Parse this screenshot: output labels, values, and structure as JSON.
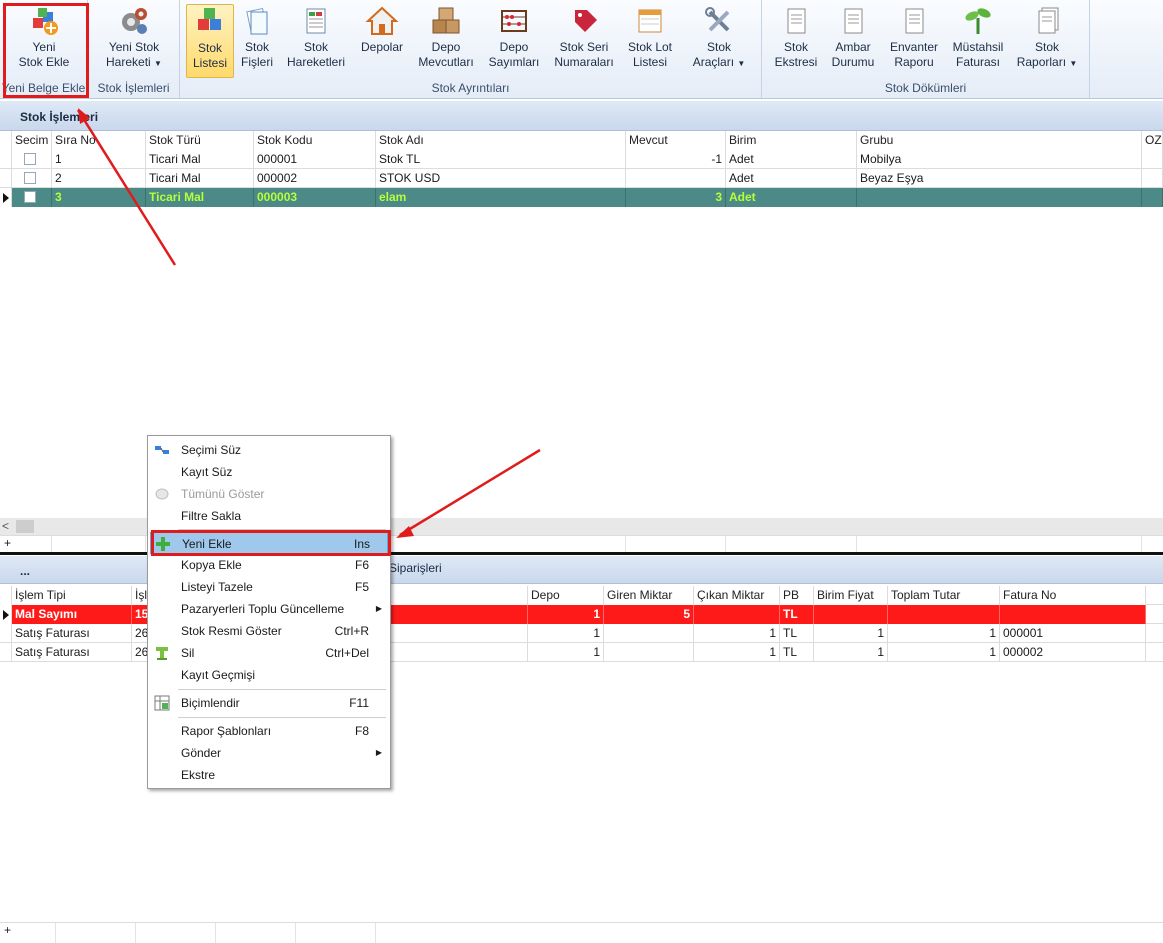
{
  "ribbon": {
    "groups": {
      "yeni_belge": {
        "label": "Yeni Belge Ekle"
      },
      "stok_islemleri": {
        "label": "Stok İşlemleri"
      },
      "stok_ayrintilari": {
        "label": "Stok Ayrıntıları"
      },
      "stok_dokumleri": {
        "label": "Stok Dökümleri"
      }
    },
    "buttons": {
      "yeni_stok_ekle": {
        "line1": "Yeni",
        "line2": "Stok Ekle"
      },
      "yeni_stok_hareketi": {
        "line1": "Yeni Stok",
        "line2": "Hareketi"
      },
      "stok_listesi": {
        "line1": "Stok",
        "line2": "Listesi"
      },
      "stok_fisleri": {
        "line1": "Stok",
        "line2": "Fişleri"
      },
      "stok_hareketleri": {
        "line1": "Stok",
        "line2": "Hareketleri"
      },
      "depolar": {
        "line1": "Depolar",
        "line2": ""
      },
      "depo_mevcutlari": {
        "line1": "Depo",
        "line2": "Mevcutları"
      },
      "depo_sayimlari": {
        "line1": "Depo",
        "line2": "Sayımları"
      },
      "stok_seri": {
        "line1": "Stok Seri",
        "line2": "Numaraları"
      },
      "stok_lot": {
        "line1": "Stok Lot",
        "line2": "Listesi"
      },
      "stok_araclari": {
        "line1": "Stok",
        "line2": "Araçları"
      },
      "stok_ekstresi": {
        "line1": "Stok",
        "line2": "Ekstresi"
      },
      "ambar_durumu": {
        "line1": "Ambar",
        "line2": "Durumu"
      },
      "envanter_raporu": {
        "line1": "Envanter",
        "line2": "Raporu"
      },
      "mustahsil": {
        "line1": "Müstahsil",
        "line2": "Faturası"
      },
      "stok_raporlari": {
        "line1": "Stok",
        "line2": "Raporları"
      }
    }
  },
  "top_panel": {
    "title": "Stok İşlemleri",
    "columns": [
      "Secim",
      "Sıra No",
      "Stok Türü",
      "Stok Kodu",
      "Stok Adı",
      "Mevcut",
      "Birim",
      "Grubu",
      "OZ"
    ],
    "rows": [
      {
        "sira": "1",
        "tur": "Ticari Mal",
        "kod": "000001",
        "ad": "Stok TL",
        "mevcut": "-1",
        "birim": "Adet",
        "grup": "Mobilya"
      },
      {
        "sira": "2",
        "tur": "Ticari Mal",
        "kod": "000002",
        "ad": "STOK USD",
        "mevcut": "",
        "birim": "Adet",
        "grup": "Beyaz Eşya"
      },
      {
        "sira": "3",
        "tur": "Ticari Mal",
        "kod": "000003",
        "ad": "elam",
        "mevcut": "3",
        "birim": "Adet",
        "grup": ""
      }
    ]
  },
  "bottom_panel": {
    "title": "...",
    "title_right": "Siparişleri",
    "columns": [
      "İşlem Tipi",
      "İşl",
      "Depo",
      "Giren Miktar",
      "Çıkan Miktar",
      "PB",
      "Birim Fiyat",
      "Toplam Tutar",
      "Fatura No"
    ],
    "rows": [
      {
        "tip": "Mal Sayımı",
        "isl": "15",
        "depo": "1",
        "giren": "5",
        "cikan": "",
        "pb": "TL",
        "fiyat": "",
        "toplam": "",
        "fatura": ""
      },
      {
        "tip": "Satış Faturası",
        "isl": "26",
        "depo": "1",
        "giren": "",
        "cikan": "1",
        "pb": "TL",
        "fiyat": "1",
        "toplam": "1",
        "fatura": "000001"
      },
      {
        "tip": "Satış Faturası",
        "isl": "26",
        "depo": "1",
        "giren": "",
        "cikan": "1",
        "pb": "TL",
        "fiyat": "1",
        "toplam": "1",
        "fatura": "000002"
      }
    ]
  },
  "footer": {
    "plus": "+"
  },
  "context_menu": {
    "items": [
      {
        "label": "Seçimi Süz",
        "key": ""
      },
      {
        "label": "Kayıt Süz",
        "key": ""
      },
      {
        "label": "Tümünü Göster",
        "key": ""
      },
      {
        "label": "Filtre Sakla",
        "key": ""
      },
      {
        "label": "Yeni Ekle",
        "key": "Ins"
      },
      {
        "label": "Kopya Ekle",
        "key": "F6"
      },
      {
        "label": "Listeyi Tazele",
        "key": "F5"
      },
      {
        "label": "Pazaryerleri Toplu Güncelleme",
        "key": ""
      },
      {
        "label": "Stok Resmi Göster",
        "key": "Ctrl+R"
      },
      {
        "label": "Sil",
        "key": "Ctrl+Del"
      },
      {
        "label": "Kayıt Geçmişi",
        "key": ""
      },
      {
        "label": "Biçimlendir",
        "key": "F11"
      },
      {
        "label": "Rapor Şablonları",
        "key": "F8"
      },
      {
        "label": "Gönder",
        "key": ""
      },
      {
        "label": "Ekstre",
        "key": ""
      }
    ]
  },
  "colors": {
    "highlight_red": "#e01b1b",
    "selected_row": "#4b8a86",
    "selected_text": "#b6ff3a",
    "red_row": "#ff1a1a",
    "menu_hover": "#9ec9ec"
  }
}
